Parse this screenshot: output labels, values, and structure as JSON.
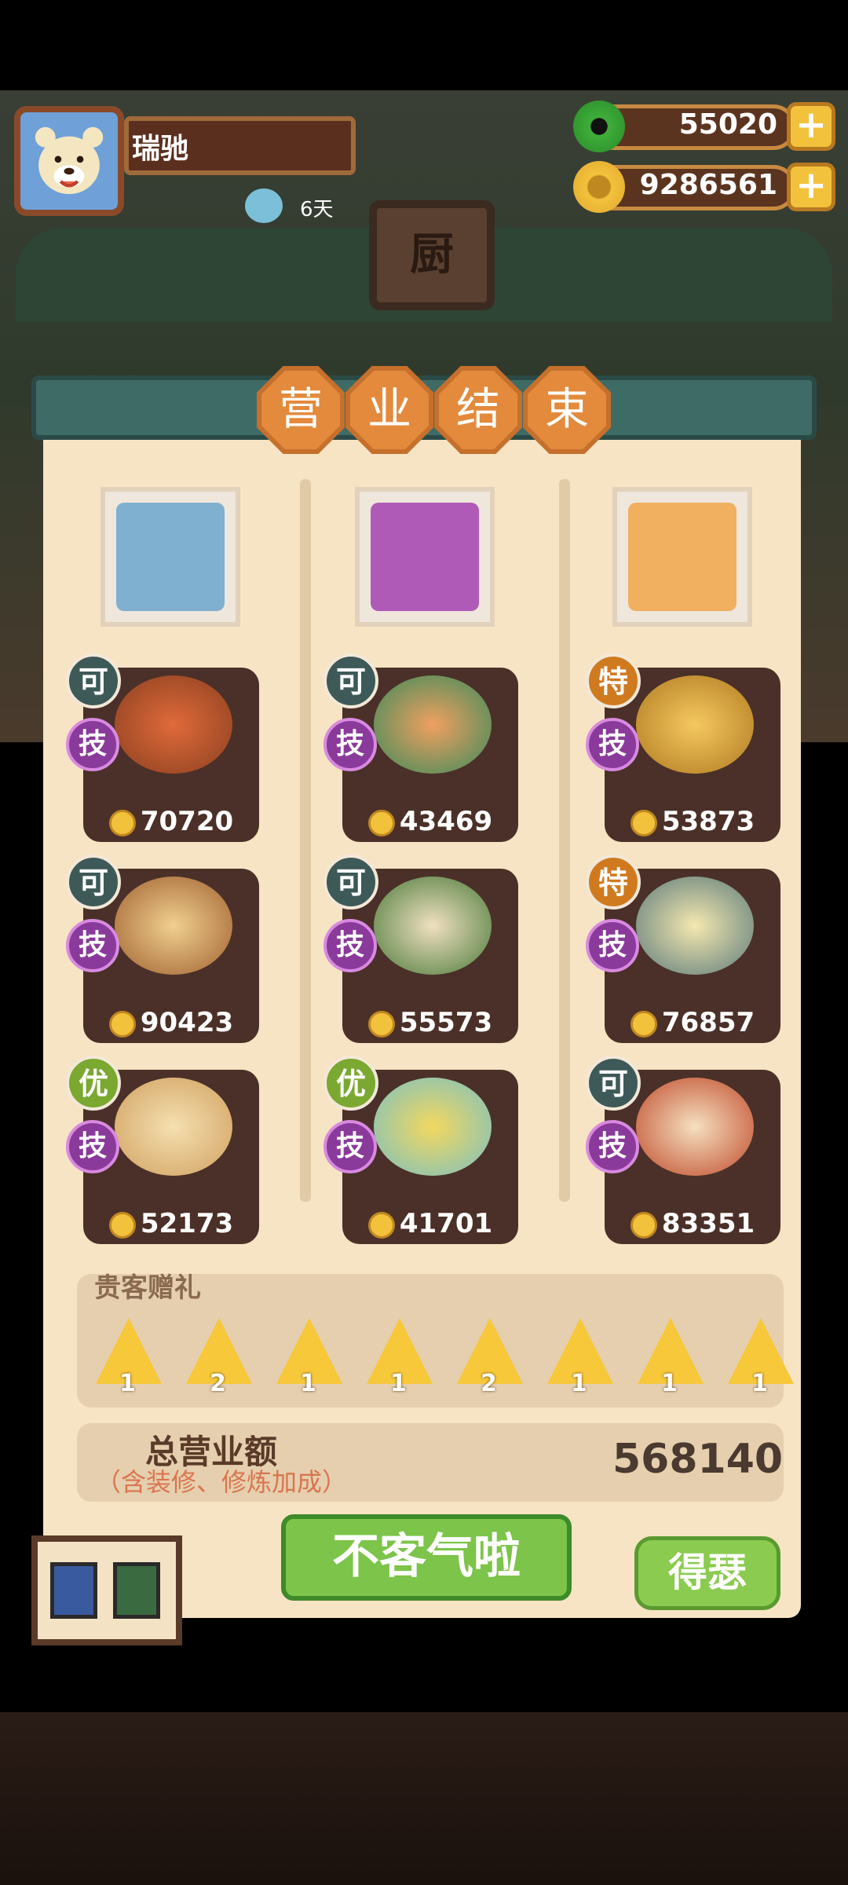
{
  "player": {
    "name": "瑞驰",
    "days": "6天"
  },
  "currency": {
    "jade": "55020",
    "coins": "9286561"
  },
  "title_chars": [
    "营",
    "业",
    "结",
    "束"
  ],
  "sign_char": "厨",
  "columns": [
    {
      "portrait_color": "#7fb0d0",
      "dishes": [
        {
          "grade": "可",
          "skill": "技",
          "price": "70720"
        },
        {
          "grade": "可",
          "skill": "技",
          "price": "90423"
        },
        {
          "grade": "优",
          "skill": "技",
          "price": "52173"
        }
      ]
    },
    {
      "portrait_color": "#b05ab8",
      "dishes": [
        {
          "grade": "可",
          "skill": "技",
          "price": "43469"
        },
        {
          "grade": "可",
          "skill": "技",
          "price": "55573"
        },
        {
          "grade": "优",
          "skill": "技",
          "price": "41701"
        }
      ]
    },
    {
      "portrait_color": "#f0b060",
      "dishes": [
        {
          "grade": "特",
          "skill": "技",
          "price": "53873"
        },
        {
          "grade": "特",
          "skill": "技",
          "price": "76857"
        },
        {
          "grade": "可",
          "skill": "技",
          "price": "83351"
        }
      ]
    }
  ],
  "grade_colors": {
    "可": "#3d5a58",
    "优": "#7aa830",
    "特": "#d07a20"
  },
  "gifts": {
    "title": "贵客赠礼",
    "counts": [
      "1",
      "2",
      "1",
      "1",
      "2",
      "1",
      "1",
      "1"
    ]
  },
  "total": {
    "label": "总营业额",
    "sublabel": "（含装修、修炼加成）",
    "value": "568140"
  },
  "buttons": {
    "primary": "不客气啦",
    "secondary": "得瑟"
  }
}
